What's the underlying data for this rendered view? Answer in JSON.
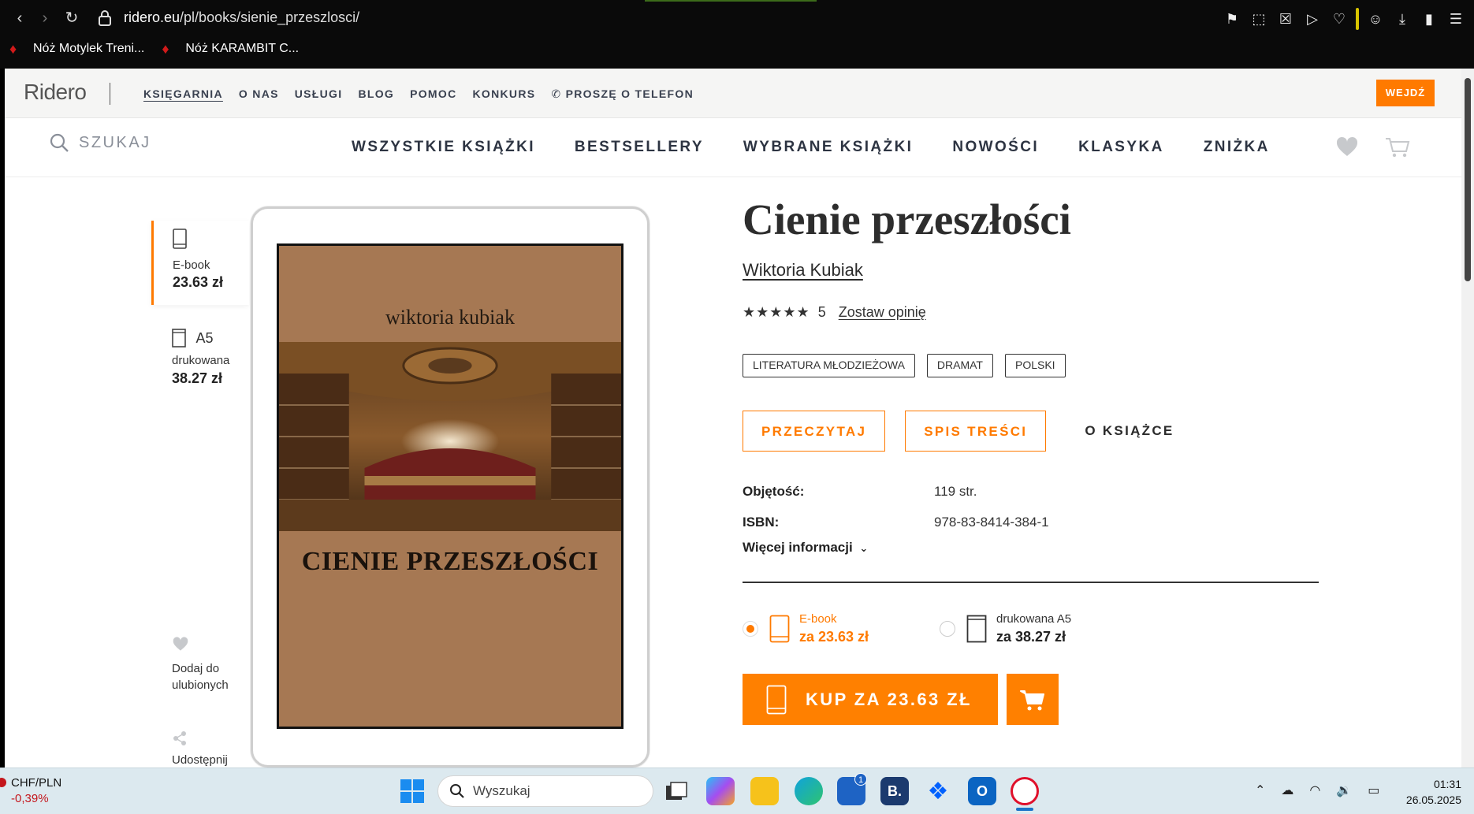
{
  "browser": {
    "url_host": "ridero.eu",
    "url_path": "/pl/books/sienie_przeszlosci/",
    "bookmarks": [
      {
        "label": "Nóż Motylek Treni..."
      },
      {
        "label": "Nóż KARAMBIT C..."
      }
    ]
  },
  "site": {
    "logo": "Ridero",
    "topnav": [
      "KSIĘGARNIA",
      "O NAS",
      "USŁUGI",
      "BLOG",
      "POMOC",
      "KONKURS",
      "PROSZĘ O TELEFON"
    ],
    "login_label": "WEJDŹ",
    "accent_color": "#ff7a00",
    "search_label": "SZUKAJ",
    "catnav": [
      "WSZYSTKIE KSIĄŻKI",
      "BESTSELLERY",
      "WYBRANE KSIĄŻKI",
      "NOWOŚCI",
      "KLASYKA",
      "ZNIŻKA"
    ]
  },
  "formats": {
    "ebook": {
      "label": "E-book",
      "price": "23.63 zł"
    },
    "print": {
      "size": "A5",
      "label": "drukowana",
      "price": "38.27 zł"
    }
  },
  "sidebar": {
    "favorite_label": "Dodaj do ulubionych",
    "share_label": "Udostępnij"
  },
  "cover": {
    "author": "wiktoria kubiak",
    "title": "CIENIE PRZESZŁOŚCI"
  },
  "book": {
    "title": "Cienie przeszłości",
    "author": "Wiktoria Kubiak",
    "rating_value": 5,
    "rating_count": "5",
    "review_link": "Zostaw opinię",
    "tags": [
      "LITERATURA MŁODZIEŻOWA",
      "DRAMAT",
      "POLSKI"
    ],
    "actions": {
      "read": "PRZECZYTAJ",
      "toc": "SPIS TREŚCI",
      "about": "O KSIĄŻCE"
    },
    "meta": [
      {
        "label": "Objętość:",
        "value": "119 str."
      },
      {
        "label": "ISBN:",
        "value": "978-83-8414-384-1"
      }
    ],
    "more_info": "Więcej informacji"
  },
  "purchase": {
    "options": [
      {
        "label": "E-book",
        "price": "za 23.63 zł",
        "selected": true
      },
      {
        "label": "drukowana A5",
        "price": "za 38.27 zł",
        "selected": false
      }
    ],
    "buy_label": "KUP ZA 23.63 ZŁ"
  },
  "taskbar": {
    "ticker_pair": "CHF/PLN",
    "ticker_change": "-0,39%",
    "search_placeholder": "Wyszukaj",
    "store_badge": "1",
    "time": "01:31",
    "date": "26.05.2025"
  }
}
